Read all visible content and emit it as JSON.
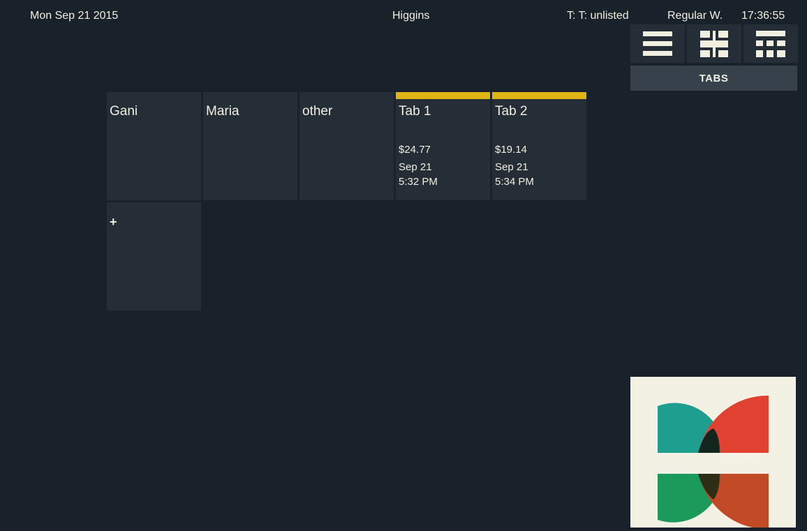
{
  "header": {
    "date": "Mon Sep 21 2015",
    "title": "Higgins",
    "terminal": "T: T: unlisted",
    "shift": "Regular W.",
    "clock": "17:36:55"
  },
  "view_switcher": {
    "buttons": [
      {
        "icon": "list-view-icon"
      },
      {
        "icon": "grid-view-icon"
      },
      {
        "icon": "table-view-icon"
      }
    ],
    "active_label": "TABS"
  },
  "tabs": [
    {
      "name": "Gani"
    },
    {
      "name": "Maria"
    },
    {
      "name": "other"
    },
    {
      "name": "Tab 1",
      "amount": "$24.77",
      "date": "Sep 21",
      "time": "5:32 PM"
    },
    {
      "name": "Tab 2",
      "amount": "$19.14",
      "date": "Sep 21",
      "time": "5:34 PM"
    }
  ],
  "add_tile": {
    "label": "+"
  },
  "colors": {
    "background": "#19212a",
    "tile": "#252d37",
    "open_tab_accent": "#dfb514",
    "text": "#f1efdf",
    "logo_teal": "#1e9e8f",
    "logo_red": "#e04131",
    "logo_green": "#1b9a5c",
    "logo_orange": "#c24a27"
  }
}
